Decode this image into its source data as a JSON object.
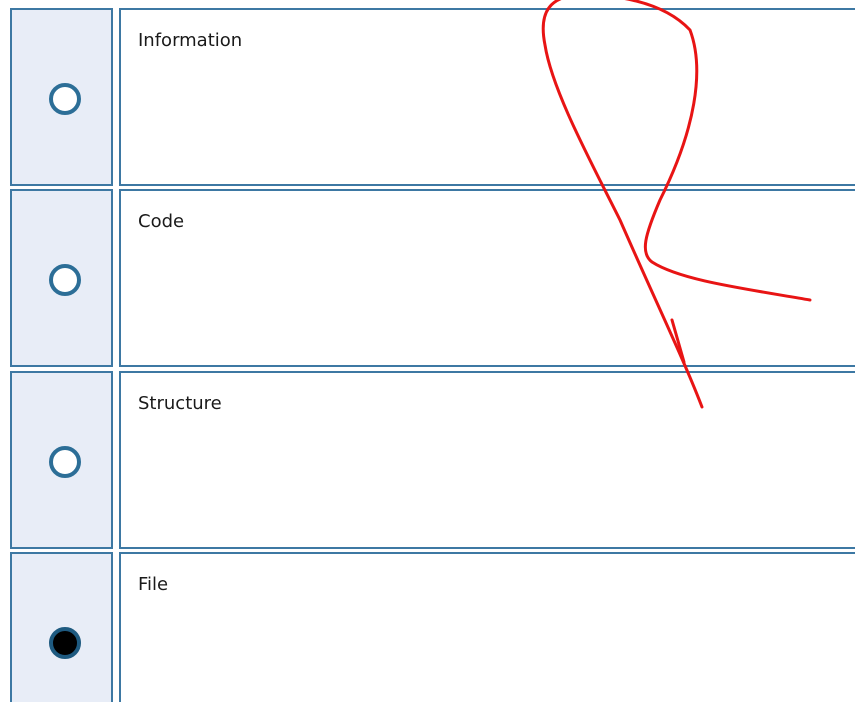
{
  "options": [
    {
      "label": "Information",
      "selected": false
    },
    {
      "label": "Code",
      "selected": false
    },
    {
      "label": "Structure",
      "selected": false
    },
    {
      "label": "File",
      "selected": true
    }
  ],
  "colors": {
    "cell_border": "#3d78a3",
    "radio_cell_background": "#e8edf7",
    "radio_ring": "#2c6e97",
    "annotation_stroke": "#e81414"
  }
}
